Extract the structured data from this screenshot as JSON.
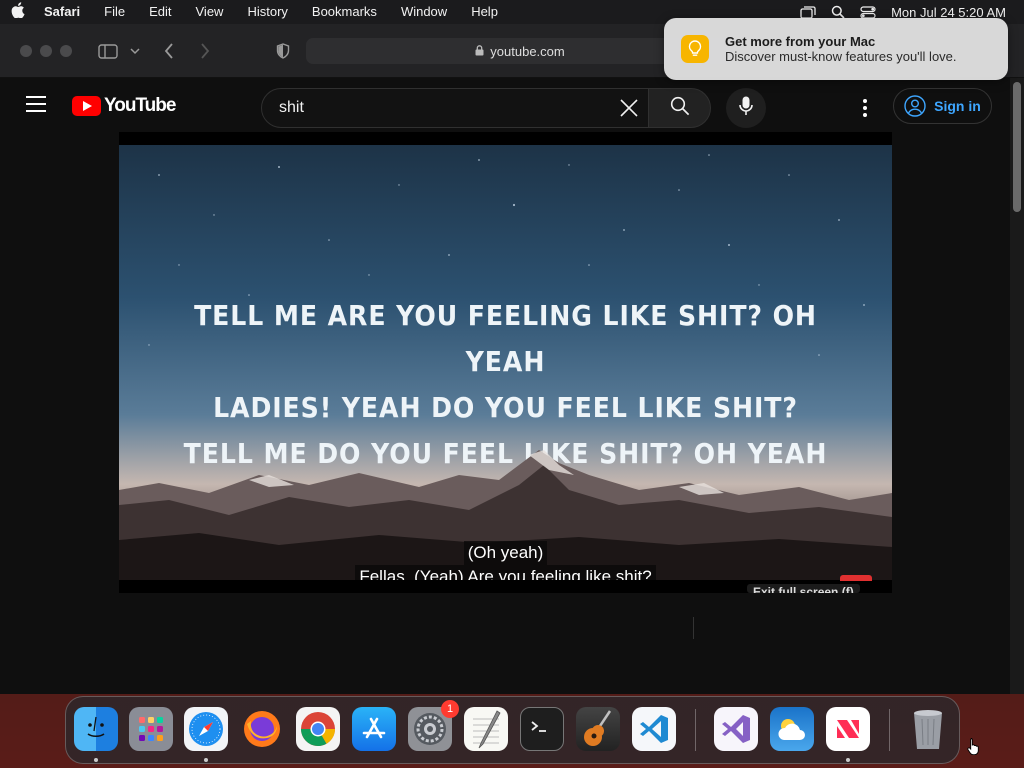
{
  "menubar": {
    "apple_icon": "apple-icon",
    "app_name": "Safari",
    "items": [
      "File",
      "Edit",
      "View",
      "History",
      "Bookmarks",
      "Window",
      "Help"
    ],
    "status_icons": [
      "screen-mirroring-icon",
      "spotlight-search-icon",
      "control-center-icon"
    ],
    "clock": "Mon Jul 24  5:20 AM"
  },
  "browser": {
    "address": "youtube.com"
  },
  "notification": {
    "title": "Get more from your Mac",
    "body": "Discover must-know features you'll love.",
    "icon": "lightbulb-icon"
  },
  "youtube": {
    "logo_text": "YouTube",
    "search_value": "shit",
    "sign_in_label": "Sign in"
  },
  "video": {
    "lyrics": [
      "TELL ME  ARE YOU FEELING LIKE SHIT?  OH YEAH",
      "LADIES!  YEAH  DO YOU FEEL LIKE SHIT?",
      "TELL ME  DO YOU FEEL LIKE SHIT?  OH YEAH"
    ],
    "captions": [
      "(Oh yeah)",
      "Fellas, (Yeah) Are you feeling like shit?"
    ],
    "exit_fullscreen": "Exit full screen (f)"
  },
  "dock": {
    "items": [
      {
        "name": "Finder",
        "icon": "finder-icon"
      },
      {
        "name": "Launchpad",
        "icon": "launchpad-icon"
      },
      {
        "name": "Safari",
        "icon": "safari-icon"
      },
      {
        "name": "Firefox",
        "icon": "firefox-icon"
      },
      {
        "name": "Chrome",
        "icon": "chrome-icon"
      },
      {
        "name": "App Store",
        "icon": "app-store-icon"
      },
      {
        "name": "System Settings",
        "icon": "system-settings-icon",
        "badge": "1"
      },
      {
        "name": "TextEdit",
        "icon": "textedit-icon"
      },
      {
        "name": "Terminal",
        "icon": "terminal-icon"
      },
      {
        "name": "GarageBand",
        "icon": "garageband-icon"
      },
      {
        "name": "Visual Studio Code",
        "icon": "vscode-icon"
      },
      {
        "name": "Visual Studio",
        "icon": "visual-studio-icon"
      },
      {
        "name": "Weather",
        "icon": "weather-icon"
      },
      {
        "name": "News",
        "icon": "news-icon"
      },
      {
        "name": "Trash",
        "icon": "trash-icon"
      }
    ]
  }
}
